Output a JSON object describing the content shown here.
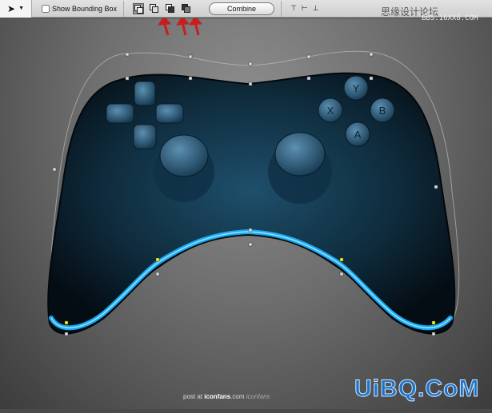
{
  "toolbar": {
    "show_bounding_box_label": "Show Bounding Box",
    "show_bounding_box_checked": false,
    "combine_label": "Combine",
    "path_ops": [
      "add-to-shape-area",
      "subtract-from-shape-area",
      "intersect-shape-areas",
      "exclude-overlapping-shape-areas"
    ]
  },
  "watermarks": {
    "forum": "思缘设计论坛",
    "bbs": "BBS.16XX8.COM",
    "site": "UiBQ.CoM"
  },
  "footer": {
    "prefix": "post at ",
    "site": "iconfans",
    "suffix": ".com",
    "logo": "iconfans"
  },
  "controller": {
    "buttons": [
      "Y",
      "X",
      "B",
      "A"
    ]
  },
  "colors": {
    "body": "#0d2230",
    "rim": "#1aa8f0",
    "button": "#2a5a7a",
    "arrow": "#c81e1e"
  }
}
